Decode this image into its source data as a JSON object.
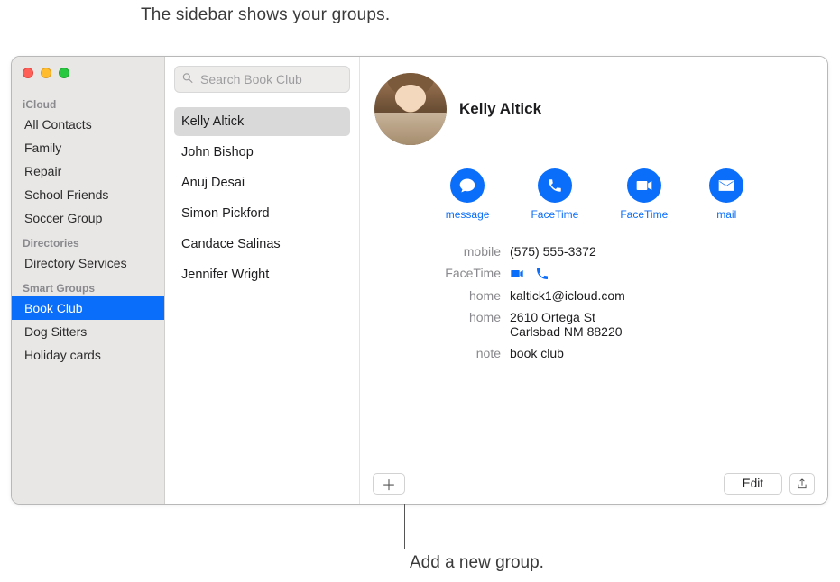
{
  "callouts": {
    "top": "The sidebar shows your groups.",
    "bottom": "Add a new group."
  },
  "sidebar": {
    "sections": [
      {
        "label": "iCloud",
        "items": [
          "All Contacts",
          "Family",
          "Repair",
          "School Friends",
          "Soccer Group"
        ]
      },
      {
        "label": "Directories",
        "items": [
          "Directory Services"
        ]
      },
      {
        "label": "Smart Groups",
        "items": [
          "Book Club",
          "Dog Sitters",
          "Holiday cards"
        ],
        "selected": "Book Club"
      }
    ]
  },
  "search": {
    "placeholder": "Search Book Club"
  },
  "contacts": {
    "items": [
      "Kelly Altick",
      "John Bishop",
      "Anuj Desai",
      "Simon Pickford",
      "Candace Salinas",
      "Jennifer Wright"
    ],
    "selected": "Kelly Altick"
  },
  "card": {
    "name": "Kelly Altick",
    "actions": [
      {
        "label": "message",
        "icon": "message"
      },
      {
        "label": "FaceTime",
        "icon": "phone"
      },
      {
        "label": "FaceTime",
        "icon": "video"
      },
      {
        "label": "mail",
        "icon": "mail"
      }
    ],
    "fields": {
      "mobile_label": "mobile",
      "mobile_value": "(575) 555-3372",
      "facetime_label": "FaceTime",
      "home_email_label": "home",
      "home_email_value": "kaltick1@icloud.com",
      "home_addr_label": "home",
      "home_addr_line1": "2610 Ortega St",
      "home_addr_line2": "Carlsbad NM 88220",
      "note_label": "note",
      "note_value": "book club"
    },
    "edit_label": "Edit"
  }
}
